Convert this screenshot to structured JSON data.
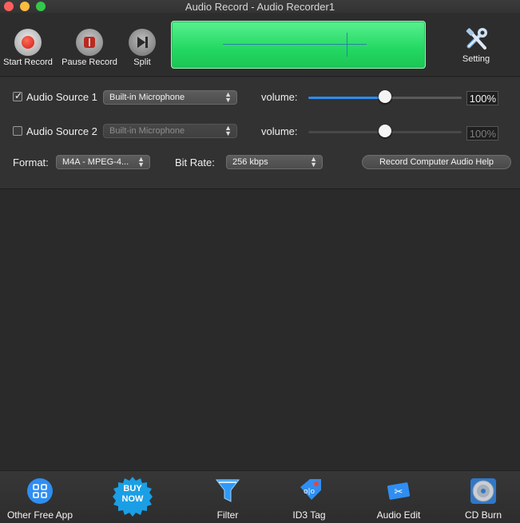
{
  "window": {
    "title": "Audio Record - Audio Recorder1"
  },
  "toolbar": {
    "start_label": "Start Record",
    "pause_label": "Pause Record",
    "split_label": "Split",
    "setting_label": "Setting"
  },
  "sources": [
    {
      "label": "Audio Source 1",
      "checked": true,
      "device": "Built-in Microphone",
      "volume_label": "volume:",
      "volume_percent": 100,
      "volume_text": "100%",
      "enabled": true
    },
    {
      "label": "Audio Source 2",
      "checked": false,
      "device": "Built-in Microphone",
      "volume_label": "volume:",
      "volume_percent": 100,
      "volume_text": "100%",
      "enabled": false
    }
  ],
  "format": {
    "label": "Format:",
    "value": "M4A - MPEG-4..."
  },
  "bitrate": {
    "label": "Bit Rate:",
    "value": "256 kbps"
  },
  "help_button": "Record Computer Audio Help",
  "bottom": {
    "other_free_app": "Other Free App",
    "buy_now": "BUY NOW",
    "filter": "Filter",
    "id3_tag": "ID3 Tag",
    "audio_edit": "Audio Edit",
    "cd_burn": "CD Burn"
  },
  "colors": {
    "waveform": "#23d862",
    "slider_fill": "#2d8cf0",
    "record_red": "#d01c10"
  }
}
